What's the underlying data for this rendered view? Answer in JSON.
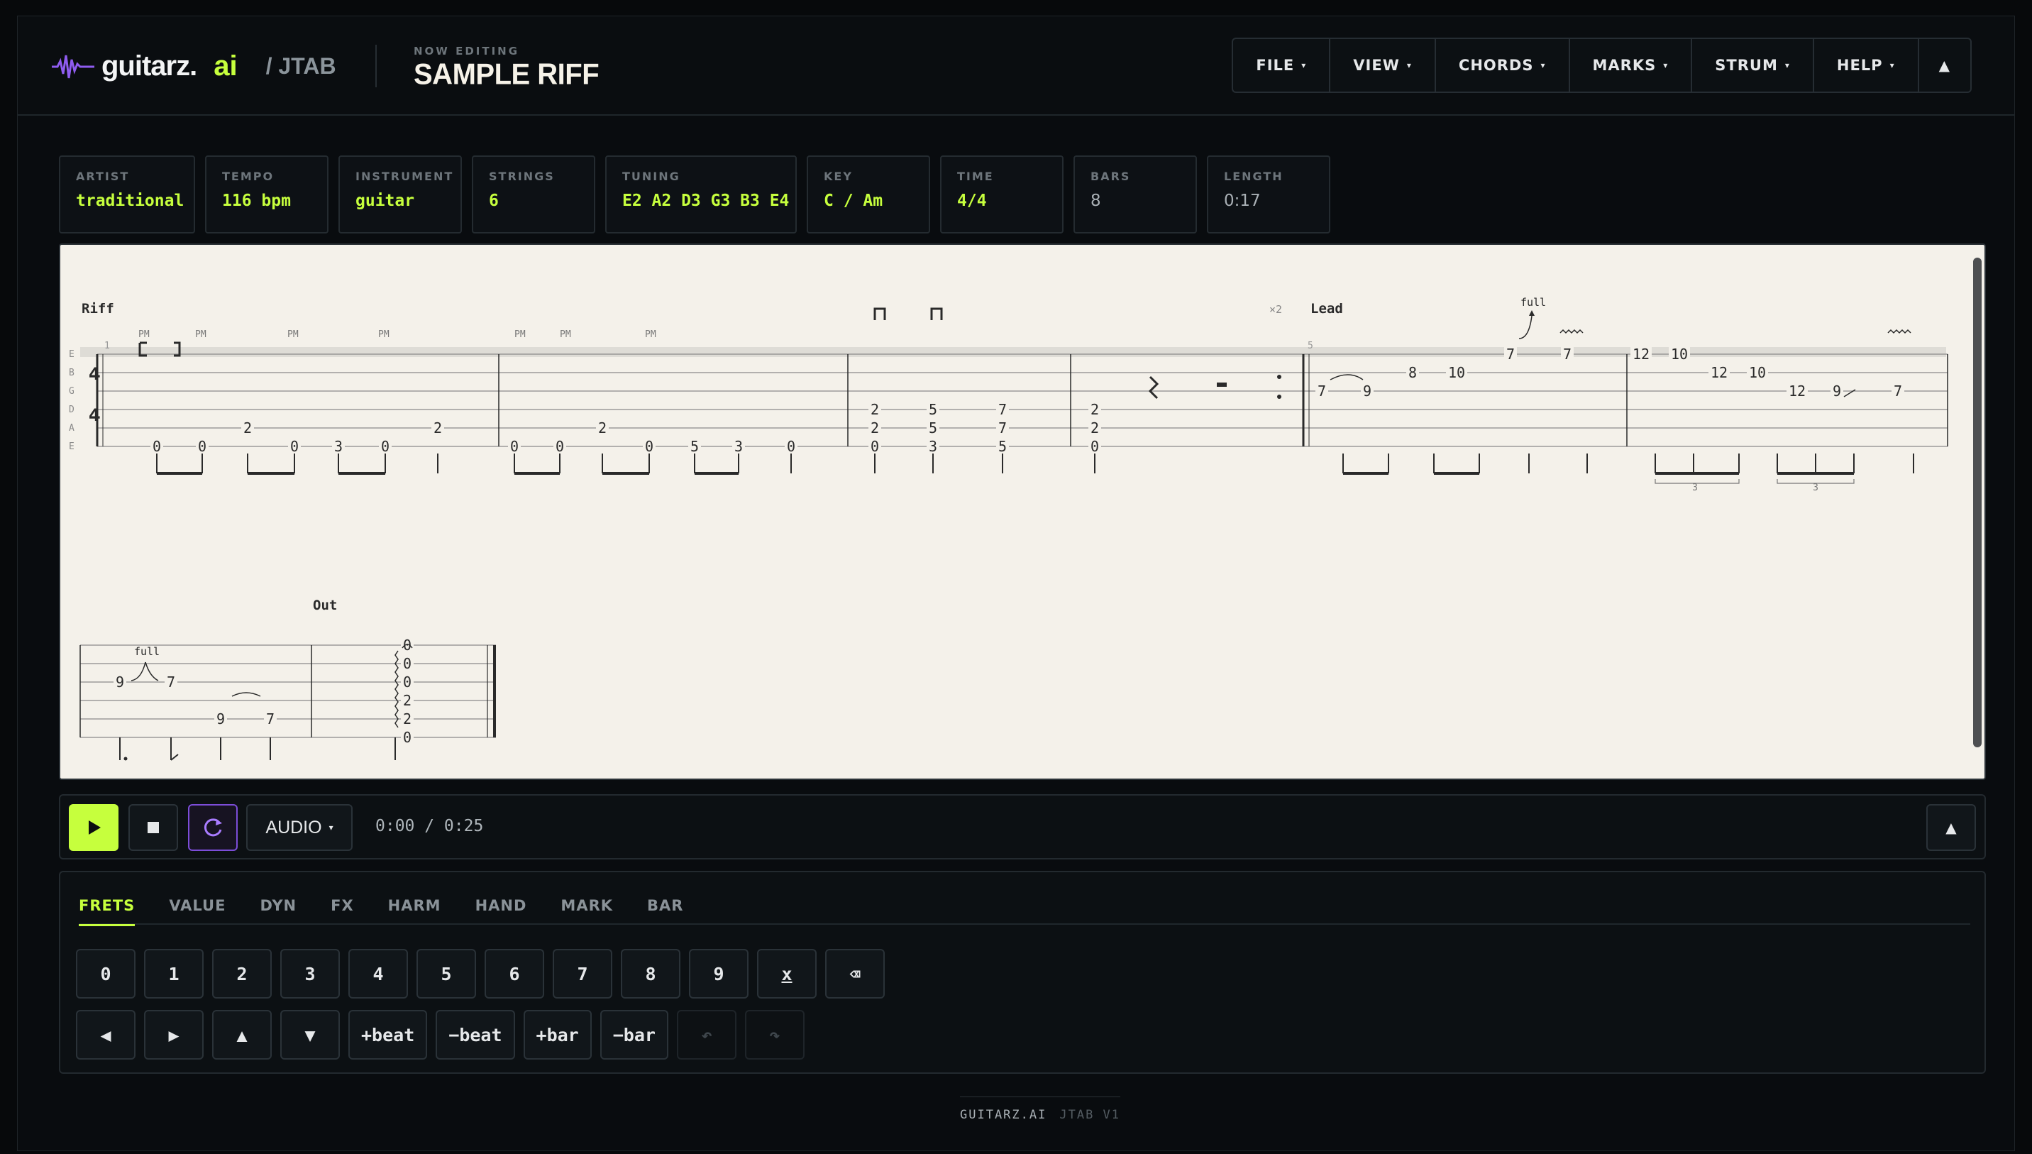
{
  "brand": {
    "name": "guitarz.",
    "ai": "ai",
    "section": "/ JTAB"
  },
  "editing": {
    "label": "NOW EDITING",
    "title": "SAMPLE RIFF"
  },
  "menu": [
    {
      "label": "FILE"
    },
    {
      "label": "VIEW"
    },
    {
      "label": "CHORDS"
    },
    {
      "label": "MARKS"
    },
    {
      "label": "STRUM"
    },
    {
      "label": "HELP"
    }
  ],
  "menu_caret": "▾",
  "collapse_icon": "▲",
  "meta": [
    {
      "key": "ARTIST",
      "value": "traditional"
    },
    {
      "key": "TEMPO",
      "value": "116 bpm"
    },
    {
      "key": "INSTRUMENT",
      "value": "guitar"
    },
    {
      "key": "STRINGS",
      "value": "6"
    },
    {
      "key": "TUNING",
      "value": "E2 A2 D3 G3 B3 E4"
    },
    {
      "key": "KEY",
      "value": "C / Am"
    },
    {
      "key": "TIME",
      "value": "4/4"
    },
    {
      "key": "BARS",
      "value": "8"
    },
    {
      "key": "LENGTH",
      "value": "0:17"
    }
  ],
  "tab": {
    "string_names": [
      "E",
      "B",
      "G",
      "D",
      "A",
      "E"
    ],
    "time_signature": [
      "4",
      "4"
    ],
    "sections": [
      "Riff",
      "Lead",
      "Out"
    ],
    "repeat": "×2",
    "bar_numbers": [
      "1",
      "5"
    ],
    "pm": "PM",
    "bend_label": "full",
    "triplet": "3"
  },
  "player": {
    "audio_label": "AUDIO",
    "time": "0:00 / 0:25"
  },
  "editor": {
    "tabs": [
      "FRETS",
      "VALUE",
      "DYN",
      "FX",
      "HARM",
      "HAND",
      "MARK",
      "BAR"
    ],
    "frets": [
      "0",
      "1",
      "2",
      "3",
      "4",
      "5",
      "6",
      "7",
      "8",
      "9",
      "x",
      "⌫"
    ],
    "nav": [
      {
        "label": "◀",
        "enabled": true
      },
      {
        "label": "▶",
        "enabled": true
      },
      {
        "label": "▲",
        "enabled": true
      },
      {
        "label": "▼",
        "enabled": true
      },
      {
        "label": "+beat",
        "enabled": true
      },
      {
        "label": "−beat",
        "enabled": true
      },
      {
        "label": "+bar",
        "enabled": true
      },
      {
        "label": "−bar",
        "enabled": true
      },
      {
        "label": "↶",
        "enabled": false
      },
      {
        "label": "↷",
        "enabled": false
      }
    ]
  },
  "footer": {
    "brand": "GUITARZ.AI",
    "version": "JTAB V1"
  },
  "colors": {
    "accent": "#c6ff3d",
    "loop": "#7c4dd8",
    "paper": "#f4f1ea"
  }
}
